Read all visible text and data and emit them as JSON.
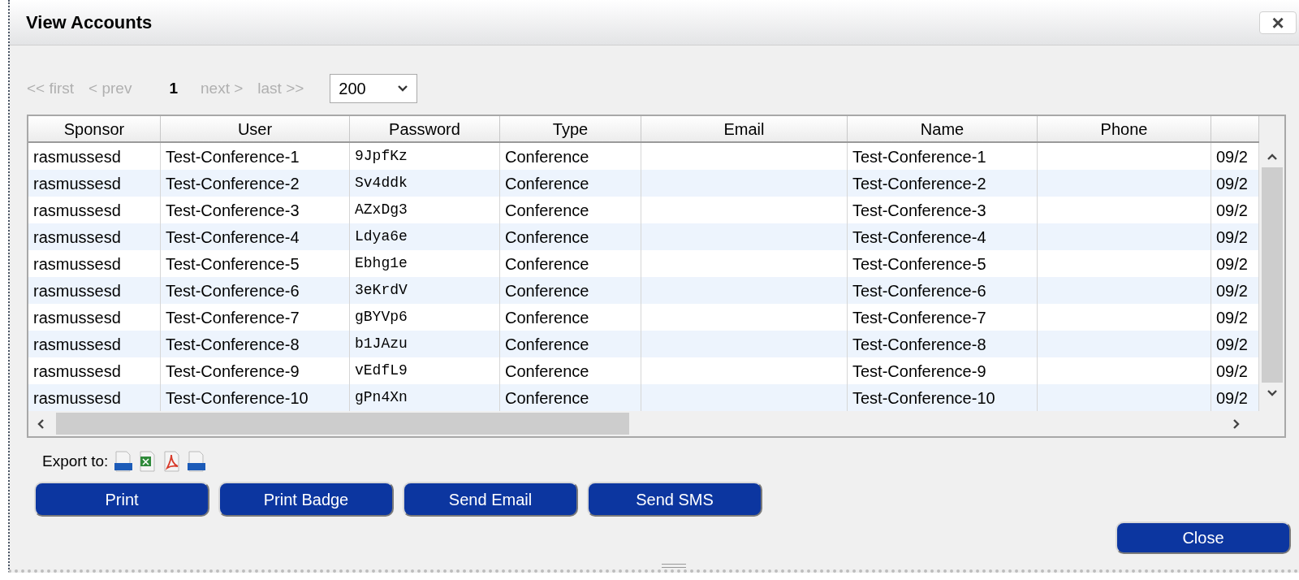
{
  "window": {
    "title": "View Accounts",
    "close_label": "×"
  },
  "pager": {
    "items": [
      {
        "kind": "link",
        "label": "<< first",
        "disabled": true
      },
      {
        "kind": "link",
        "label": "< prev",
        "disabled": true
      },
      {
        "kind": "page",
        "label": "1"
      },
      {
        "kind": "link",
        "label": "next >",
        "disabled": true
      },
      {
        "kind": "link",
        "label": "last >>",
        "disabled": true
      }
    ],
    "page_size": "200"
  },
  "table": {
    "columns": [
      "Sponsor",
      "User",
      "Password",
      "Type",
      "Email",
      "Name",
      "Phone",
      ""
    ],
    "rows": [
      [
        "rasmussesd",
        "Test-Conference-1",
        "9JpfKz",
        "Conference",
        "",
        "Test-Conference-1",
        "",
        "09/2"
      ],
      [
        "rasmussesd",
        "Test-Conference-2",
        "Sv4ddk",
        "Conference",
        "",
        "Test-Conference-2",
        "",
        "09/2"
      ],
      [
        "rasmussesd",
        "Test-Conference-3",
        "AZxDg3",
        "Conference",
        "",
        "Test-Conference-3",
        "",
        "09/2"
      ],
      [
        "rasmussesd",
        "Test-Conference-4",
        "Ldya6e",
        "Conference",
        "",
        "Test-Conference-4",
        "",
        "09/2"
      ],
      [
        "rasmussesd",
        "Test-Conference-5",
        "Ebhg1e",
        "Conference",
        "",
        "Test-Conference-5",
        "",
        "09/2"
      ],
      [
        "rasmussesd",
        "Test-Conference-6",
        "3eKrdV",
        "Conference",
        "",
        "Test-Conference-6",
        "",
        "09/2"
      ],
      [
        "rasmussesd",
        "Test-Conference-7",
        "gBYVp6",
        "Conference",
        "",
        "Test-Conference-7",
        "",
        "09/2"
      ],
      [
        "rasmussesd",
        "Test-Conference-8",
        "b1JAzu",
        "Conference",
        "",
        "Test-Conference-8",
        "",
        "09/2"
      ],
      [
        "rasmussesd",
        "Test-Conference-9",
        "vEdfL9",
        "Conference",
        "",
        "Test-Conference-9",
        "",
        "09/2"
      ],
      [
        "rasmussesd",
        "Test-Conference-10",
        "gPn4Xn",
        "Conference",
        "",
        "Test-Conference-10",
        "",
        "09/2"
      ]
    ]
  },
  "export": {
    "label": "Export to:",
    "formats": [
      {
        "kind": "csv"
      },
      {
        "kind": "excel"
      },
      {
        "kind": "pdf"
      },
      {
        "kind": "rtf"
      }
    ]
  },
  "buttons": [
    "Print",
    "Print Badge",
    "Send Email",
    "Send SMS"
  ],
  "close_button": "Close"
}
